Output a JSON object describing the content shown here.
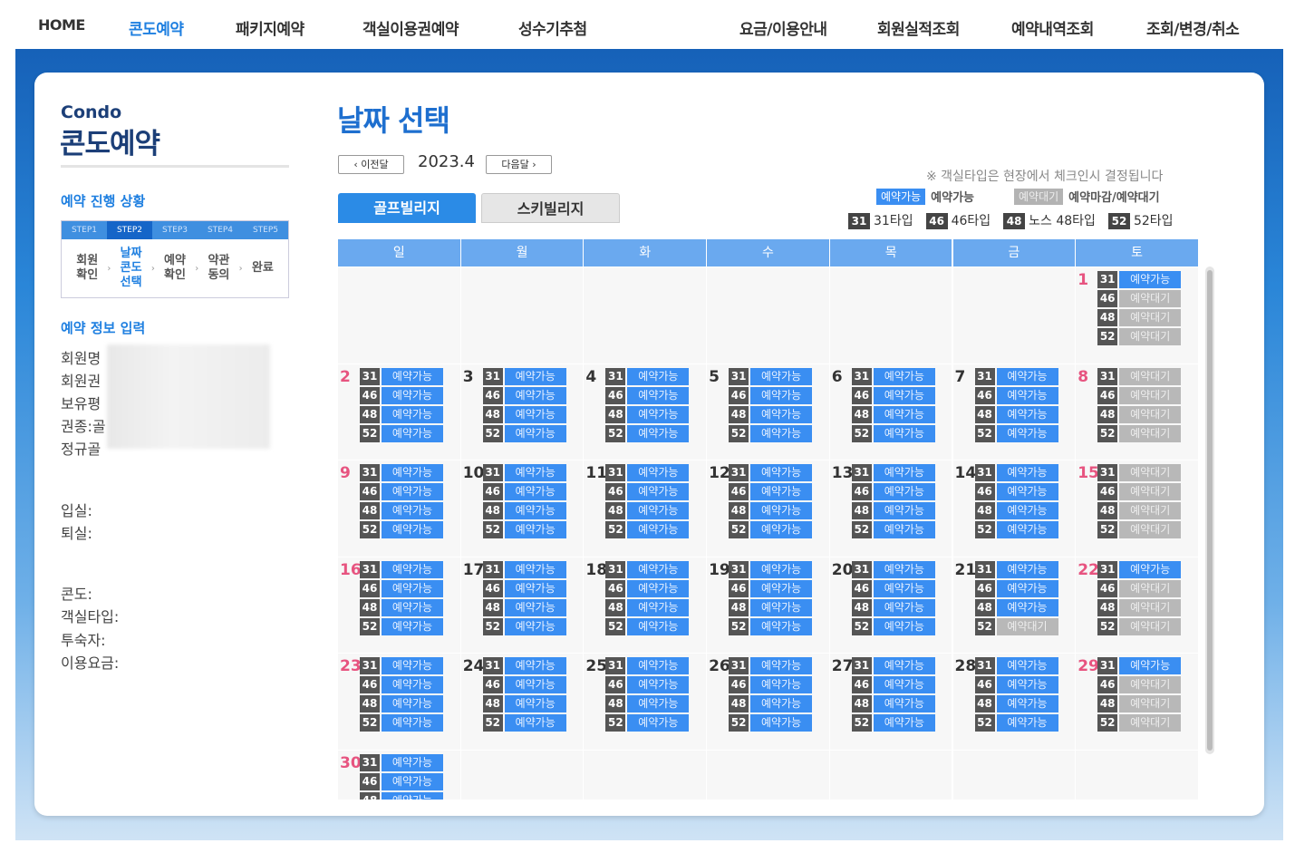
{
  "nav": {
    "left": [
      "HOME",
      "콘도예약",
      "패키지예약",
      "객실이용권예약",
      "성수기추첨"
    ],
    "right": [
      "요금/이용안내",
      "회원실적조회",
      "예약내역조회",
      "조회/변경/취소"
    ]
  },
  "sidebar": {
    "brand_en": "Condo",
    "brand_ko": "콘도예약",
    "progress_title": "예약 진행 상황",
    "step_tabs": [
      "STEP1",
      "STEP2",
      "STEP3",
      "STEP4",
      "STEP5"
    ],
    "step_labels": [
      "회원\n확인",
      "날짜\n콘도\n선택",
      "예약\n확인",
      "약관\n동의",
      "완료"
    ],
    "info_title": "예약 정보 입력",
    "info_labels": [
      "회원명",
      "회원권",
      "보유평",
      "권종:골",
      "정규골"
    ],
    "stay_labels": [
      "입실:",
      "퇴실:"
    ],
    "detail_labels": [
      "콘도:",
      "객실타입:",
      "투숙자:",
      "이용요금:"
    ]
  },
  "main": {
    "title": "날짜 선택",
    "prev_label": "‹  이전달",
    "next_label": "다음달  ›",
    "month": "2023.4",
    "tabs": [
      "골프빌리지",
      "스키빌리지"
    ],
    "note": "※ 객실타입은 현장에서 체크인시 결정됩니다",
    "legend_avail_pill": "예약가능",
    "legend_avail_text": "예약가능",
    "legend_wait_pill": "예약대기",
    "legend_wait_text": "예약마감/예약대기",
    "types": [
      {
        "code": "31",
        "label": "31타입"
      },
      {
        "code": "46",
        "label": "46타입"
      },
      {
        "code": "48",
        "label": "노스 48타입"
      },
      {
        "code": "52",
        "label": "52타입"
      }
    ]
  },
  "calendar": {
    "weekdays": [
      "일",
      "월",
      "화",
      "수",
      "목",
      "금",
      "토"
    ],
    "avail": "예약가능",
    "wait": "예약대기",
    "days": [
      {
        "d": "1",
        "col": 6,
        "row": 0,
        "red": true,
        "s": [
          "b",
          "g",
          "g",
          "g"
        ]
      },
      {
        "d": "2",
        "col": 0,
        "row": 1,
        "red": true,
        "s": [
          "b",
          "b",
          "b",
          "b"
        ]
      },
      {
        "d": "3",
        "col": 1,
        "row": 1,
        "red": false,
        "s": [
          "b",
          "b",
          "b",
          "b"
        ]
      },
      {
        "d": "4",
        "col": 2,
        "row": 1,
        "red": false,
        "s": [
          "b",
          "b",
          "b",
          "b"
        ]
      },
      {
        "d": "5",
        "col": 3,
        "row": 1,
        "red": false,
        "s": [
          "b",
          "b",
          "b",
          "b"
        ]
      },
      {
        "d": "6",
        "col": 4,
        "row": 1,
        "red": false,
        "s": [
          "b",
          "b",
          "b",
          "b"
        ]
      },
      {
        "d": "7",
        "col": 5,
        "row": 1,
        "red": false,
        "s": [
          "b",
          "b",
          "b",
          "b"
        ]
      },
      {
        "d": "8",
        "col": 6,
        "row": 1,
        "red": true,
        "s": [
          "g",
          "g",
          "g",
          "g"
        ]
      },
      {
        "d": "9",
        "col": 0,
        "row": 2,
        "red": true,
        "s": [
          "b",
          "b",
          "b",
          "b"
        ]
      },
      {
        "d": "10",
        "col": 1,
        "row": 2,
        "red": false,
        "s": [
          "b",
          "b",
          "b",
          "b"
        ]
      },
      {
        "d": "11",
        "col": 2,
        "row": 2,
        "red": false,
        "s": [
          "b",
          "b",
          "b",
          "b"
        ]
      },
      {
        "d": "12",
        "col": 3,
        "row": 2,
        "red": false,
        "s": [
          "b",
          "b",
          "b",
          "b"
        ]
      },
      {
        "d": "13",
        "col": 4,
        "row": 2,
        "red": false,
        "s": [
          "b",
          "b",
          "b",
          "b"
        ]
      },
      {
        "d": "14",
        "col": 5,
        "row": 2,
        "red": false,
        "s": [
          "b",
          "b",
          "b",
          "b"
        ]
      },
      {
        "d": "15",
        "col": 6,
        "row": 2,
        "red": true,
        "s": [
          "g",
          "g",
          "g",
          "g"
        ]
      },
      {
        "d": "16",
        "col": 0,
        "row": 3,
        "red": true,
        "s": [
          "b",
          "b",
          "b",
          "b"
        ]
      },
      {
        "d": "17",
        "col": 1,
        "row": 3,
        "red": false,
        "s": [
          "b",
          "b",
          "b",
          "b"
        ]
      },
      {
        "d": "18",
        "col": 2,
        "row": 3,
        "red": false,
        "s": [
          "b",
          "b",
          "b",
          "b"
        ]
      },
      {
        "d": "19",
        "col": 3,
        "row": 3,
        "red": false,
        "s": [
          "b",
          "b",
          "b",
          "b"
        ]
      },
      {
        "d": "20",
        "col": 4,
        "row": 3,
        "red": false,
        "s": [
          "b",
          "b",
          "b",
          "b"
        ]
      },
      {
        "d": "21",
        "col": 5,
        "row": 3,
        "red": false,
        "s": [
          "b",
          "b",
          "b",
          "g"
        ]
      },
      {
        "d": "22",
        "col": 6,
        "row": 3,
        "red": true,
        "s": [
          "b",
          "g",
          "g",
          "g"
        ]
      },
      {
        "d": "23",
        "col": 0,
        "row": 4,
        "red": true,
        "s": [
          "b",
          "b",
          "b",
          "b"
        ]
      },
      {
        "d": "24",
        "col": 1,
        "row": 4,
        "red": false,
        "s": [
          "b",
          "b",
          "b",
          "b"
        ]
      },
      {
        "d": "25",
        "col": 2,
        "row": 4,
        "red": false,
        "s": [
          "b",
          "b",
          "b",
          "b"
        ]
      },
      {
        "d": "26",
        "col": 3,
        "row": 4,
        "red": false,
        "s": [
          "b",
          "b",
          "b",
          "b"
        ]
      },
      {
        "d": "27",
        "col": 4,
        "row": 4,
        "red": false,
        "s": [
          "b",
          "b",
          "b",
          "b"
        ]
      },
      {
        "d": "28",
        "col": 5,
        "row": 4,
        "red": false,
        "s": [
          "b",
          "b",
          "b",
          "b"
        ]
      },
      {
        "d": "29",
        "col": 6,
        "row": 4,
        "red": true,
        "s": [
          "b",
          "g",
          "g",
          "g"
        ]
      },
      {
        "d": "30",
        "col": 0,
        "row": 5,
        "red": true,
        "s": [
          "b",
          "b",
          "b",
          "b"
        ]
      }
    ]
  },
  "colors": {
    "accent": "#1e7fe0",
    "available": "#3a8ef2",
    "waiting": "#b8b8b8",
    "holiday": "#e75480"
  }
}
